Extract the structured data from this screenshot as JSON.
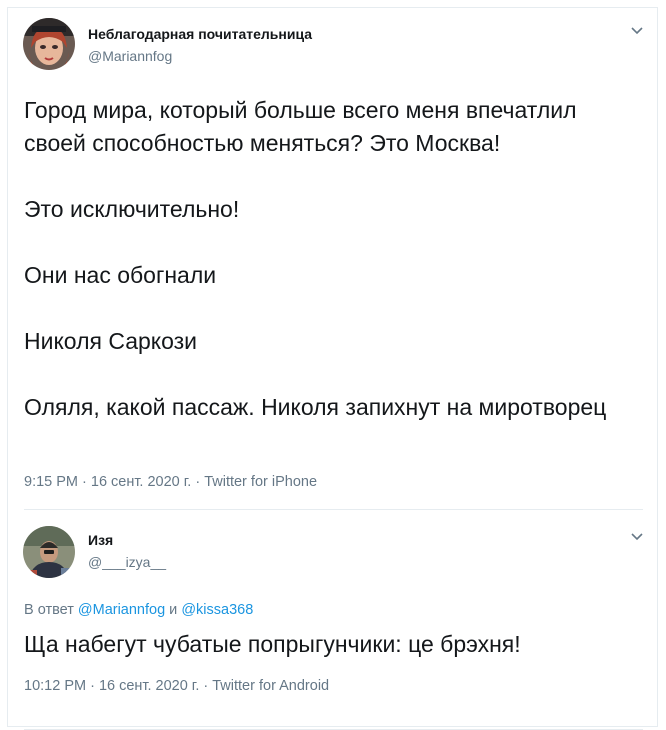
{
  "tweets": [
    {
      "author_name": "Неблагодарная почитательница",
      "author_handle": "@Mariannfog",
      "paragraphs": [
        "Город мира, который больше всего меня впечатлил своей способностью меняться? Это Москва!",
        "Это исключительно!",
        "Они нас обогнали",
        "Николя Саркози",
        "Оляля, какой пассаж. Николя запихнут на миротворец"
      ],
      "time": "9:15 PM · 16 сент. 2020 г. · ",
      "source": "Twitter for iPhone",
      "icons": {
        "menu": "chevron-down-icon"
      }
    },
    {
      "author_name": "Изя",
      "author_handle": "@___izya__",
      "reply_prefix": "В ответ ",
      "reply_user1": "@Mariannfog",
      "reply_and": " и ",
      "reply_user2": "@kissa368",
      "text": "Ща набегут чубатые попрыгунчики: це брэхня!",
      "time": "10:12 PM · 16 сент. 2020 г. · ",
      "source": "Twitter for Android",
      "icons": {
        "menu": "chevron-down-icon"
      }
    }
  ],
  "colors": {
    "link": "#1b95e0",
    "secondary": "#657786",
    "border": "#e6ecf0"
  }
}
